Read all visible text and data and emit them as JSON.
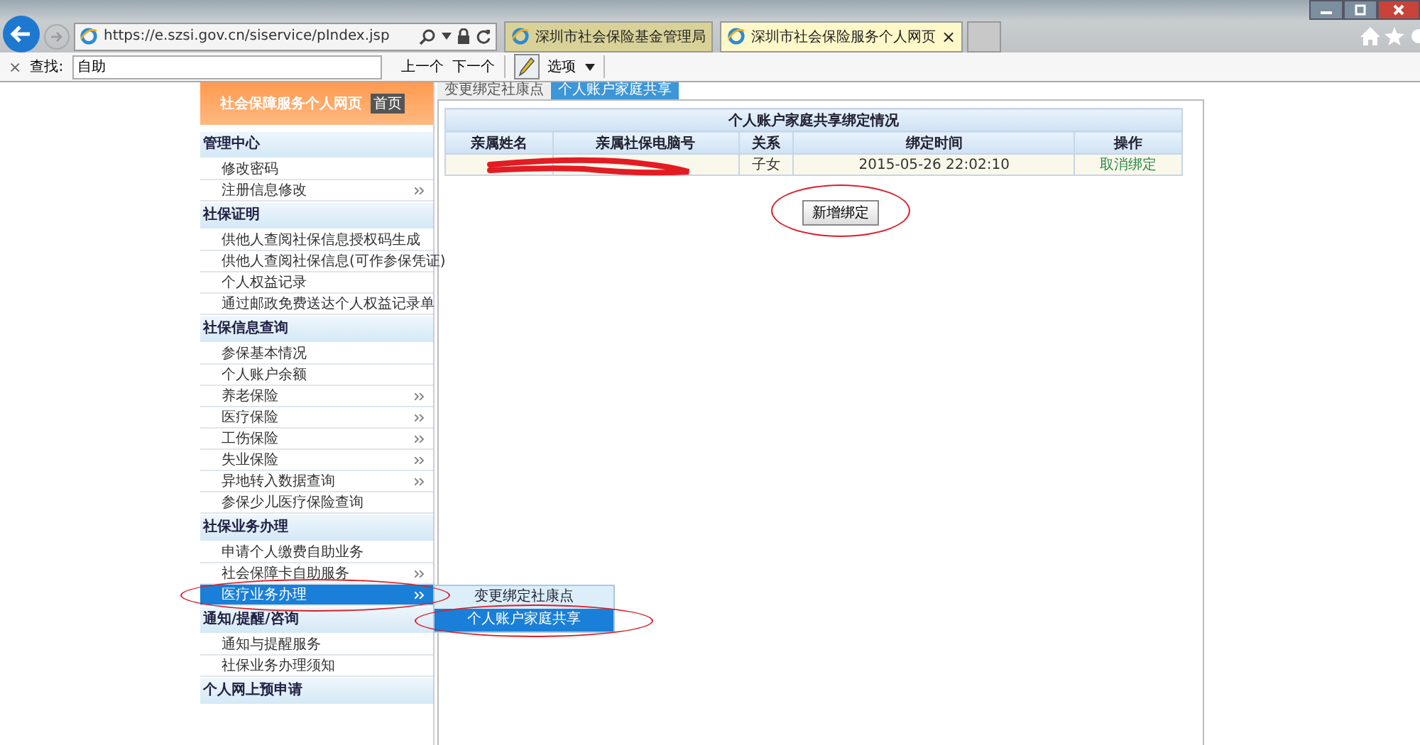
{
  "browser": {
    "url": "https://e.szsi.gov.cn/siservice/pIndex.jsp",
    "tabs": [
      {
        "title": "深圳市社会保险基金管理局",
        "selected": false
      },
      {
        "title": "深圳市社会保险服务个人网页",
        "selected": true,
        "close": "×"
      }
    ],
    "find_bar": {
      "close": "×",
      "label": "查找:",
      "value": "自助",
      "prev": "上一个",
      "next": "下一个",
      "options": "选项"
    }
  },
  "site": {
    "banner": "社会保障服务个人网页",
    "home": "首页"
  },
  "sidebar": [
    {
      "title": "管理中心",
      "items": [
        {
          "label": "修改密码",
          "more": false,
          "selected": false
        },
        {
          "label": "注册信息修改",
          "more": true,
          "selected": false
        }
      ]
    },
    {
      "title": "社保证明",
      "items": [
        {
          "label": "供他人查阅社保信息授权码生成",
          "more": false,
          "selected": false
        },
        {
          "label": "供他人查阅社保信息(可作参保凭证)",
          "more": false,
          "selected": false
        },
        {
          "label": "个人权益记录",
          "more": false,
          "selected": false
        },
        {
          "label": "通过邮政免费送达个人权益记录单",
          "more": false,
          "selected": false
        }
      ]
    },
    {
      "title": "社保信息查询",
      "items": [
        {
          "label": "参保基本情况",
          "more": false,
          "selected": false
        },
        {
          "label": "个人账户余额",
          "more": false,
          "selected": false
        },
        {
          "label": "养老保险",
          "more": true,
          "selected": false
        },
        {
          "label": "医疗保险",
          "more": true,
          "selected": false
        },
        {
          "label": "工伤保险",
          "more": true,
          "selected": false
        },
        {
          "label": "失业保险",
          "more": true,
          "selected": false
        },
        {
          "label": "异地转入数据查询",
          "more": true,
          "selected": false
        },
        {
          "label": "参保少儿医疗保险查询",
          "more": false,
          "selected": false
        }
      ]
    },
    {
      "title": "社保业务办理",
      "items": [
        {
          "label": "申请个人缴费自助业务",
          "more": false,
          "selected": false
        },
        {
          "label": "社会保障卡自助服务",
          "more": true,
          "selected": false
        },
        {
          "label": "医疗业务办理",
          "more": true,
          "selected": true
        }
      ]
    },
    {
      "title": "通知/提醒/咨询",
      "items": [
        {
          "label": "通知与提醒服务",
          "more": false,
          "selected": false
        },
        {
          "label": "社保业务办理须知",
          "more": false,
          "selected": false
        }
      ]
    },
    {
      "title": "个人网上预申请"
    }
  ],
  "flyout": [
    {
      "label": "变更绑定社康点",
      "selected": false
    },
    {
      "label": "个人账户家庭共享",
      "selected": true
    }
  ],
  "content": {
    "tabs": [
      {
        "label": "变更绑定社康点",
        "selected": false
      },
      {
        "label": "个人账户家庭共享",
        "selected": true
      }
    ],
    "table": {
      "title": "个人账户家庭共享绑定情况",
      "columns": [
        "亲属姓名",
        "亲属社保电脑号",
        "关系",
        "绑定时间",
        "操作"
      ],
      "rows": [
        {
          "relation": "子女",
          "time": "2015-05-26 22:02:10",
          "action": "取消绑定"
        }
      ]
    },
    "add_button": "新增绑定"
  }
}
